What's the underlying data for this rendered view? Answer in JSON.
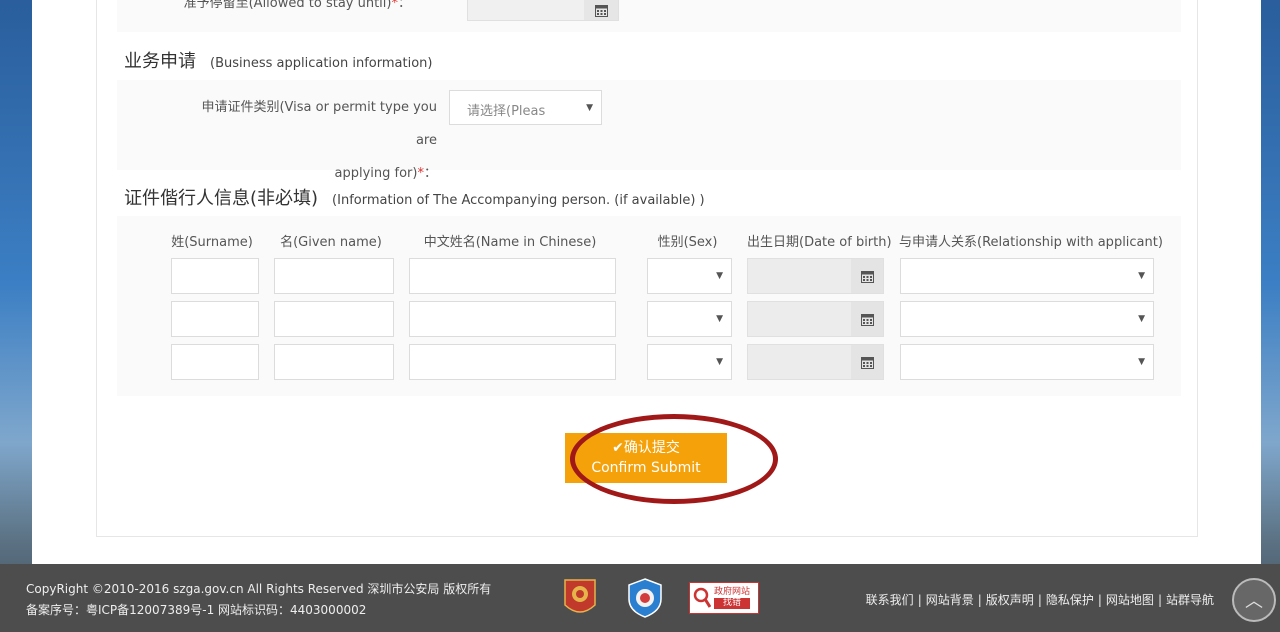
{
  "top_row": {
    "label": "准予停留至(Allowed to stay until)",
    "required_mark": "*",
    "colon": "："
  },
  "business": {
    "title": "业务申请",
    "subtitle": "(Business application information)",
    "visa_label_line1": "申请证件类别(Visa or permit type you are",
    "visa_label_line2": "applying for)",
    "required_mark": "*",
    "colon": "：",
    "visa_select_value": "请选择(Pleas"
  },
  "accompanying": {
    "title": "证件偕行人信息(非必填)",
    "subtitle": "(Information of The Accompanying person. (if available) )",
    "columns": [
      "姓(Surname)",
      "名(Given name)",
      "中文姓名(Name in Chinese)",
      "性别(Sex)",
      "出生日期(Date of birth)",
      "与申请人关系(Relationship with applicant)"
    ]
  },
  "submit": {
    "line1": "✔确认提交",
    "line2": "Confirm Submit"
  },
  "footer": {
    "copyright": "CopyRight ©2010-2016 szga.gov.cn All Rights Reserved 深圳市公安局 版权所有",
    "icp": "备案序号：粤ICP备12007389号-1 网站标识码：4403000002",
    "badge3_text_top": "政府网站",
    "badge3_text_bottom": "找错",
    "links": [
      "联系我们",
      "网站背景",
      "版权声明",
      "隐私保护",
      "网站地图",
      "站群导航"
    ]
  },
  "colors": {
    "submit": "#f5a10a",
    "highlight_ellipse": "#a01818",
    "required": "#e03030",
    "footer_bg": "#4d4d4d"
  },
  "icons": {
    "calendar": "calendar-icon",
    "caret": "caret-down-icon",
    "check": "check-icon",
    "to_top": "chevron-up-icon"
  }
}
